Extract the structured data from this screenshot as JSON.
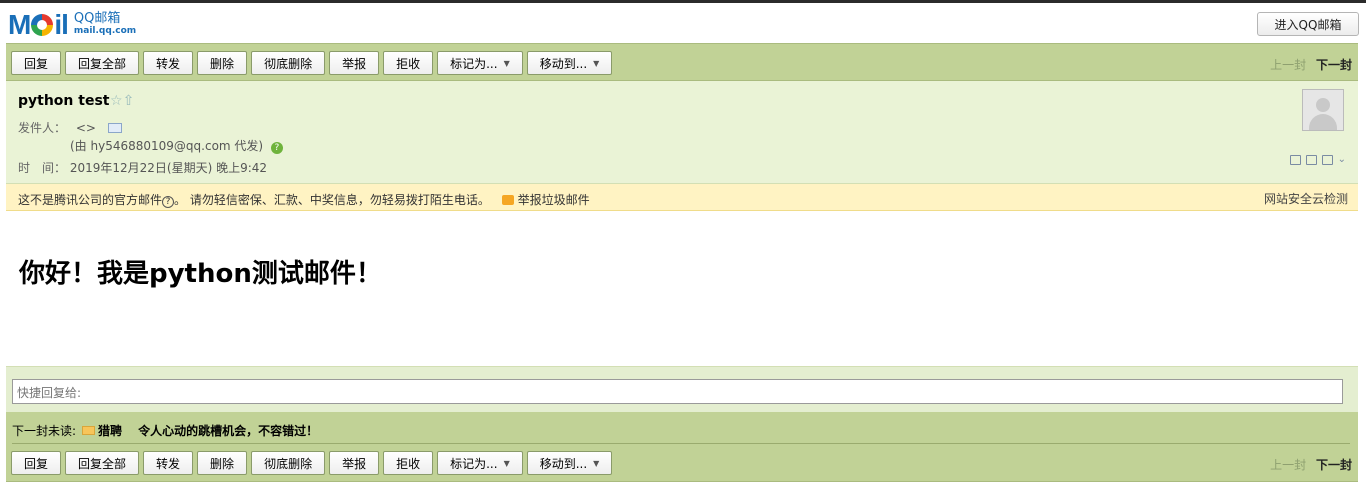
{
  "header": {
    "logo_word": "Mail",
    "logo_cn": "QQ邮箱",
    "logo_domain": "mail.qq.com",
    "enter_button": "进入QQ邮箱"
  },
  "toolbar": {
    "reply": "回复",
    "reply_all": "回复全部",
    "forward": "转发",
    "delete": "删除",
    "delete_permanent": "彻底删除",
    "report": "举报",
    "reject": "拒收",
    "mark_as": "标记为...",
    "move_to": "移动到...",
    "prev": "上一封",
    "next": "下一封"
  },
  "mail": {
    "subject": "python test",
    "from_label": "发件人：",
    "from_value": "<>",
    "via": "(由 hy546880109@qq.com 代发)",
    "time_label": "时　间：",
    "time_value": "2019年12月22日(星期天) 晚上9:42",
    "body": "你好！我是python测试邮件！"
  },
  "warning": {
    "text1": "这不是腾讯公司的官方邮件",
    "text2": "。  请勿轻信密保、汇款、中奖信息，勿轻易拨打陌生电话。",
    "report_link": "举报垃圾邮件",
    "right_link": "网站安全云检测"
  },
  "quick_reply": {
    "placeholder": "快捷回复给:"
  },
  "next_unread": {
    "label": "下一封未读:",
    "sender": "猎聘",
    "subject": "令人心动的跳槽机会，不容错过！"
  },
  "icons": {
    "star": "star-icon",
    "up": "up-arrow-icon",
    "contact_card": "contact-card-icon",
    "help": "help-icon",
    "envelope": "envelope-icon"
  },
  "colors": {
    "toolbar_bg": "#c1d296",
    "header_bg": "#eaf3d6",
    "warning_bg": "#fff3c3",
    "brand_blue": "#1a6fb8"
  }
}
